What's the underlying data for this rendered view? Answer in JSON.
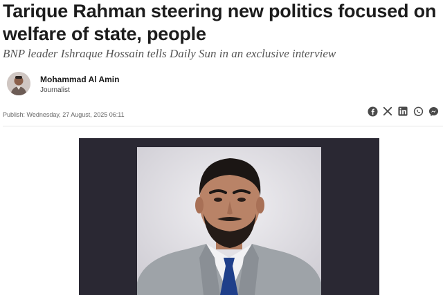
{
  "article": {
    "headline": "Tarique Rahman steering new politics focused on welfare of state, people",
    "subheadline": "BNP leader Ishraque Hossain tells Daily Sun in an exclusive interview",
    "publish_date": "Publish: Wednesday, 27 August, 2025 06:11"
  },
  "author": {
    "name": "Mohammad Al Amin",
    "role": "Journalist"
  },
  "share": {
    "icons": [
      "facebook-icon",
      "x-icon",
      "linkedin-icon",
      "whatsapp-icon",
      "messenger-icon"
    ]
  },
  "colors": {
    "headline": "#1c1c1c",
    "subheadline": "#555555",
    "photo_frame": "#2a2833",
    "share_icon": "#4a4a4a"
  }
}
